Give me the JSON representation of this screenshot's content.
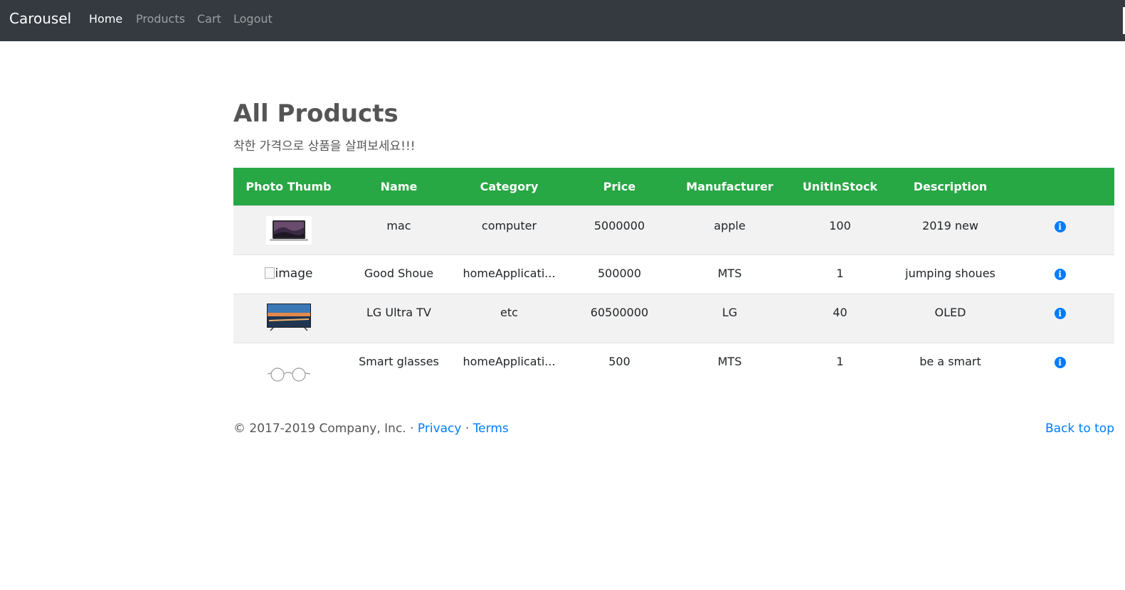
{
  "nav": {
    "brand": "Carousel",
    "links": [
      "Home",
      "Products",
      "Cart",
      "Logout"
    ],
    "active": "Home"
  },
  "heading": {
    "title": "All Products",
    "subtitle": "착한 가격으로 상품을 살펴보세요!!!"
  },
  "table": {
    "headers": [
      "Photo Thumb",
      "Name",
      "Category",
      "Price",
      "Manufacturer",
      "UnitInStock",
      "Description",
      ""
    ],
    "rows": [
      {
        "thumb": "laptop-image",
        "name": "mac",
        "category": "computer",
        "price": "5000000",
        "manufacturer": "apple",
        "stock": "100",
        "description": "2019 new",
        "action_icon": "info-icon"
      },
      {
        "thumb": "broken-image",
        "thumb_alt": "image",
        "name": "Good Shoue",
        "category": "homeApplicati...",
        "price": "500000",
        "manufacturer": "MTS",
        "stock": "1",
        "description": "jumping shoues",
        "action_icon": "info-icon"
      },
      {
        "thumb": "tv-image",
        "name": "LG Ultra TV",
        "category": "etc",
        "price": "60500000",
        "manufacturer": "LG",
        "stock": "40",
        "description": "OLED",
        "action_icon": "info-icon"
      },
      {
        "thumb": "glasses-image",
        "name": "Smart glasses",
        "category": "homeApplicati...",
        "price": "500",
        "manufacturer": "MTS",
        "stock": "1",
        "description": "be a smart",
        "action_icon": "info-icon"
      }
    ]
  },
  "footer": {
    "copyright": "© 2017-2019 Company, Inc. · ",
    "privacy": "Privacy",
    "separator": " · ",
    "terms": "Terms",
    "back_to_top": "Back to top"
  },
  "colors": {
    "navbar": "#343a40",
    "header_green": "#28a745",
    "link_blue": "#007bff",
    "stripe": "#f2f2f2"
  }
}
